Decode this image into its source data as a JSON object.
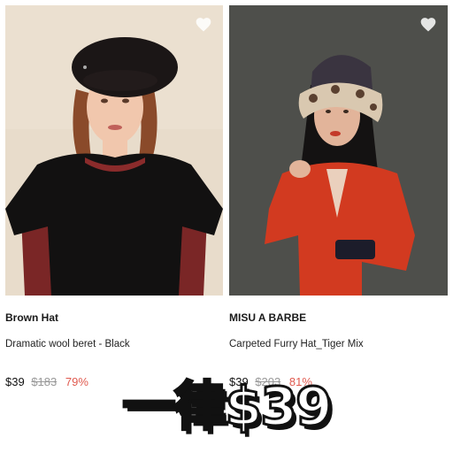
{
  "products": [
    {
      "brand": "Brown Hat",
      "name": "Dramatic wool beret - Black",
      "price": "$39",
      "original_price": "$183",
      "discount": "79%"
    },
    {
      "brand": "MISU A BARBE",
      "name": "Carpeted Furry Hat_Tiger Mix",
      "price": "$39",
      "original_price": "$203",
      "discount": "81%"
    }
  ],
  "promo_text": "一律$39",
  "icons": {
    "favorite": "heart-icon"
  },
  "colors": {
    "discount": "#e05a4f",
    "original_price": "#999999",
    "text": "#1a1a1a"
  }
}
